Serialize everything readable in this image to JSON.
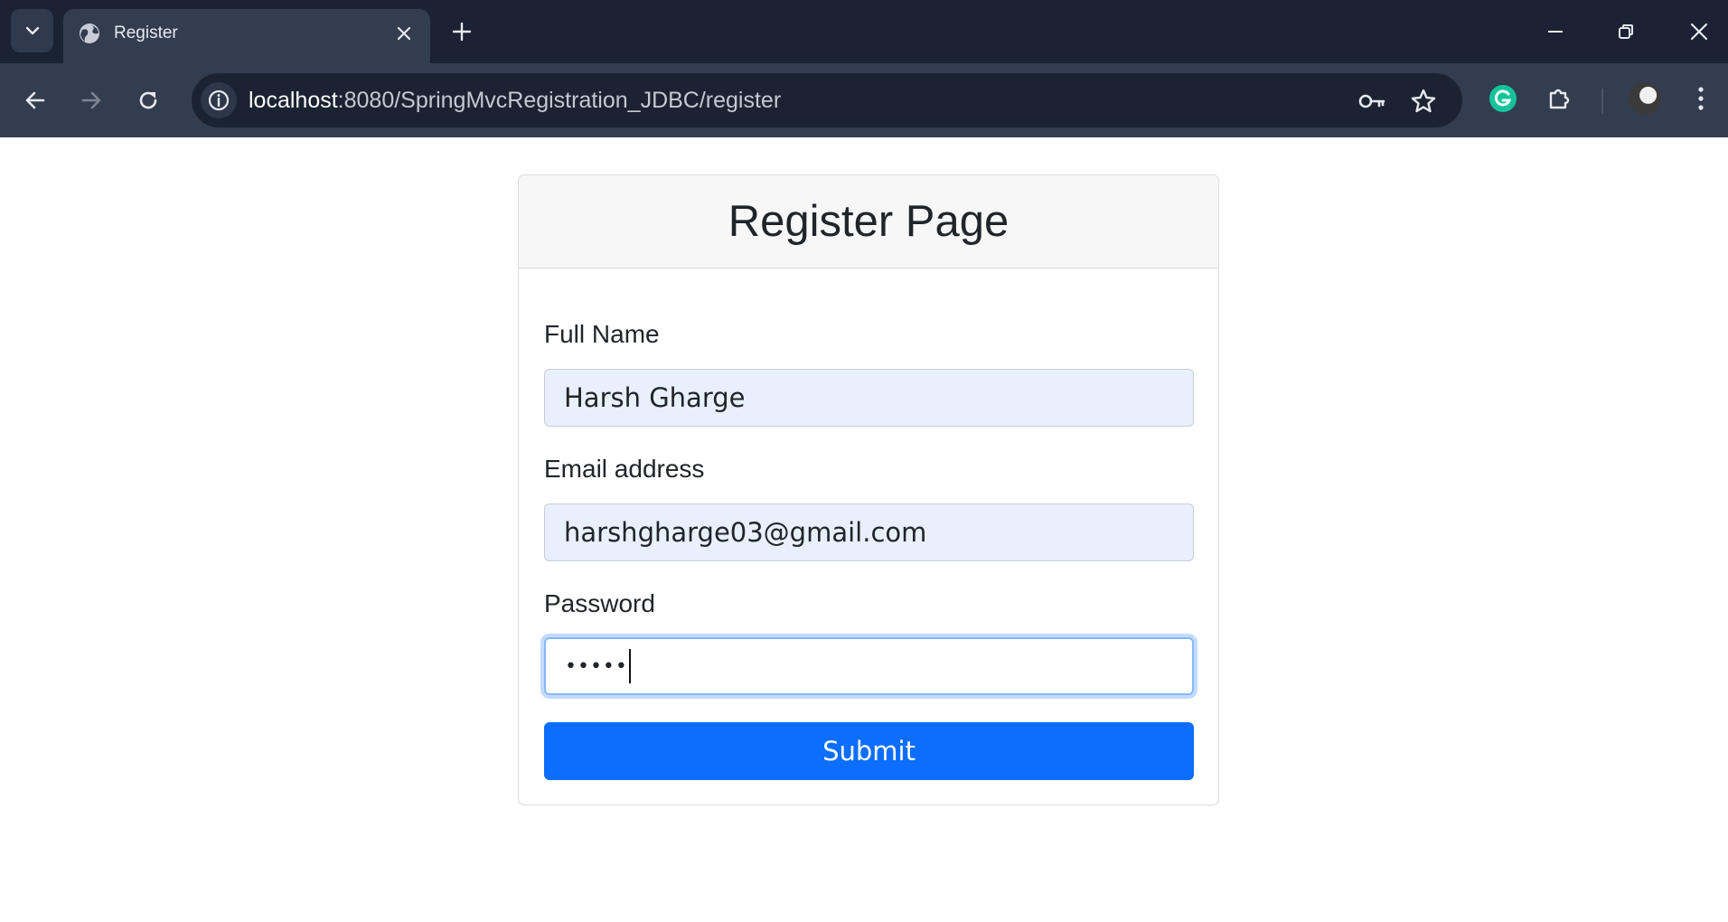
{
  "browser": {
    "tab_title": "Register",
    "url_host": "localhost",
    "url_rest": ":8080/SpringMvcRegistration_JDBC/register"
  },
  "page": {
    "heading": "Register Page",
    "full_name_label": "Full Name",
    "full_name_value": "Harsh Gharge",
    "email_label": "Email address",
    "email_value": "harshgharge03@gmail.com",
    "password_label": "Password",
    "password_value": "•••••",
    "submit_label": "Submit"
  }
}
